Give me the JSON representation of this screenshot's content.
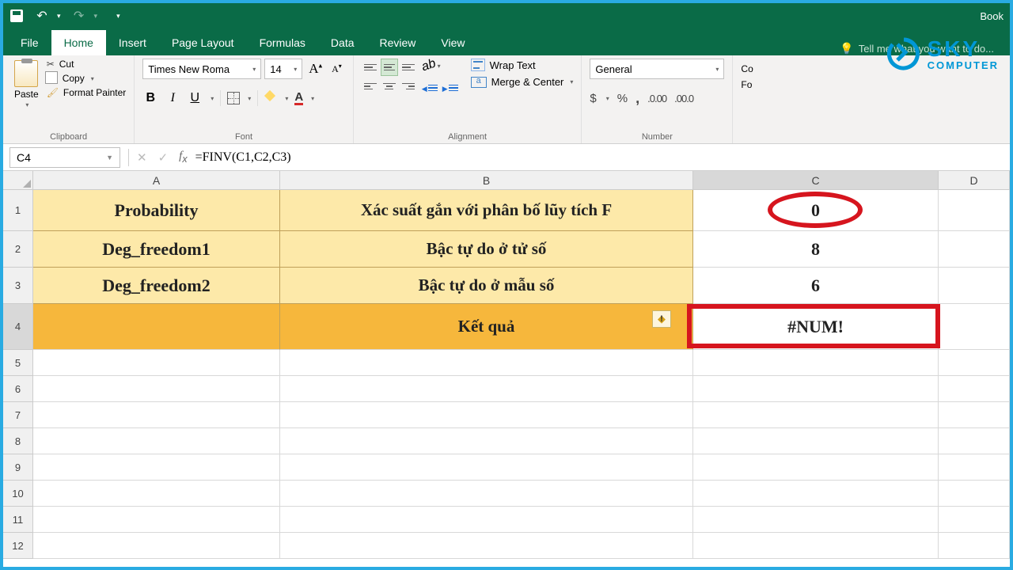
{
  "title_right": "Book",
  "tabs": {
    "file": "File",
    "home": "Home",
    "insert": "Insert",
    "page_layout": "Page Layout",
    "formulas": "Formulas",
    "data": "Data",
    "review": "Review",
    "view": "View"
  },
  "tell_me": "Tell me what you want to do...",
  "clipboard": {
    "paste": "Paste",
    "cut": "Cut",
    "copy": "Copy",
    "format_painter": "Format Painter",
    "label": "Clipboard"
  },
  "font": {
    "name": "Times New Roma",
    "size": "14",
    "label": "Font"
  },
  "alignment": {
    "wrap": "Wrap Text",
    "merge": "Merge & Center",
    "label": "Alignment"
  },
  "number": {
    "format": "General",
    "label": "Number"
  },
  "trunc": {
    "cond": "Co",
    "format": "Fo"
  },
  "name_box": "C4",
  "formula": "=FINV(C1,C2,C3)",
  "columns": {
    "a": "A",
    "b": "B",
    "c": "C",
    "d": "D"
  },
  "rows": {
    "r1": {
      "a": "Probability",
      "b": "Xác suất gắn với phân bố lũy tích F",
      "c": "0"
    },
    "r2": {
      "a": "Deg_freedom1",
      "b": "Bậc tự do ở tử số",
      "c": "8"
    },
    "r3": {
      "a": "Deg_freedom2",
      "b": "Bậc tự do ở mẫu số",
      "c": "6"
    },
    "r4": {
      "b": "Kết quả",
      "c": "#NUM!"
    }
  },
  "row_nums": [
    "1",
    "2",
    "3",
    "4",
    "5",
    "6",
    "7",
    "8",
    "9",
    "10",
    "11",
    "12"
  ],
  "logo": {
    "top": "SKY",
    "bottom": "COMPUTER"
  },
  "symbols": {
    "dollar": "$",
    "percent": "%",
    "comma": ",",
    "dec_inc": ".0 .00",
    "dec_dec": ".00 .0"
  }
}
